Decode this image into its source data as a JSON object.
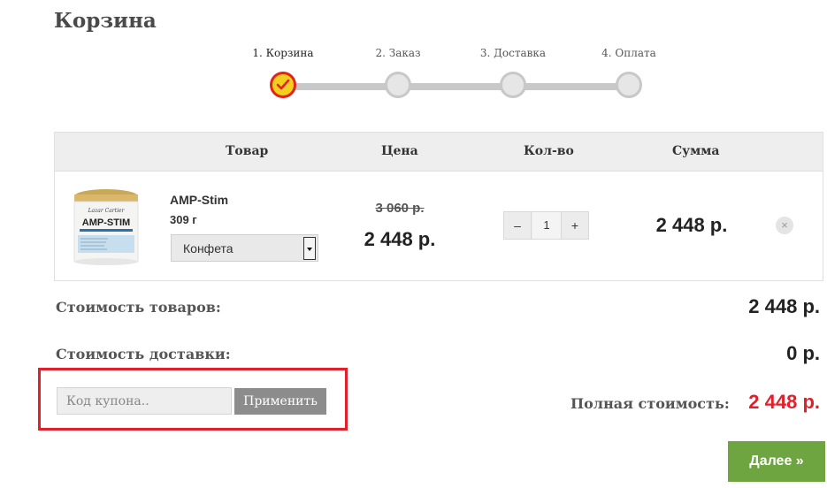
{
  "page": {
    "title": "Корзина"
  },
  "steps": [
    {
      "label": "1. Корзина",
      "active": true
    },
    {
      "label": "2. Заказ",
      "active": false
    },
    {
      "label": "3. Доставка",
      "active": false
    },
    {
      "label": "4. Оплата",
      "active": false
    }
  ],
  "table": {
    "headers": {
      "product": "Товар",
      "price": "Цена",
      "qty": "Кол-во",
      "sum": "Сумма"
    },
    "items": [
      {
        "name": "AMP-Stim",
        "weight": "309 г",
        "flavor": "Конфета",
        "old_price": "3 060 р.",
        "price": "2 448 р.",
        "qty": "1",
        "qty_minus": "–",
        "qty_plus": "+",
        "sum": "2 448 р.",
        "remove": "×",
        "image": {
          "brand": "Lazar Cartier",
          "label": "AMP-STIM",
          "colors": {
            "lid": "#d9b86c",
            "body": "#f4f4f2"
          }
        }
      }
    ]
  },
  "totals": {
    "goods_label": "Стоимость товаров:",
    "goods_value": "2 448 р.",
    "delivery_label": "Стоимость доставки:",
    "delivery_value": "0 р.",
    "full_label": "Полная стоимость:",
    "full_value": "2 448 р."
  },
  "coupon": {
    "placeholder": "Код купона..",
    "apply_label": "Применить"
  },
  "next_button": "Далее »",
  "colors": {
    "accent_red": "#e0202a",
    "green": "#6ea541",
    "step_yellow": "#f3cf1d"
  }
}
